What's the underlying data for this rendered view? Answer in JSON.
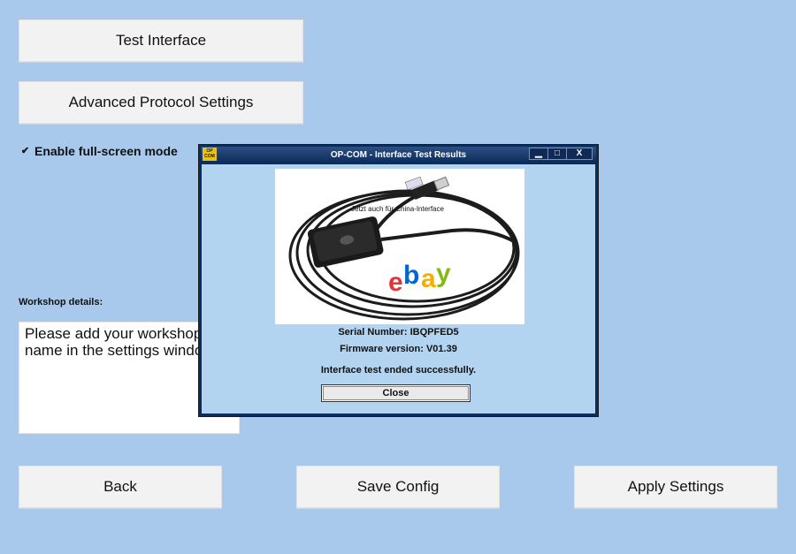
{
  "buttons": {
    "test_interface": "Test Interface",
    "advanced_protocol": "Advanced Protocol Settings",
    "back": "Back",
    "save_config": "Save Config",
    "apply_settings": "Apply Settings"
  },
  "fullscreen": {
    "checked": true,
    "check_glyph": "✔",
    "label": "Enable full-screen mode"
  },
  "workshop": {
    "label": "Workshop details:",
    "text": "Please add your workshop\nname in the settings window"
  },
  "dialog": {
    "icon_text": "OP COM",
    "title": "OP-COM - Interface Test Results",
    "minimize_glyph": "▁",
    "maximize_glyph": "□",
    "close_glyph": "X",
    "photo_caption": "Jetzt auch für China-Interface",
    "photo_watermark": "ebay",
    "serial": "Serial Number: IBQPFED5",
    "firmware": "Firmware version: V01.39",
    "result": "Interface test ended successfully.",
    "close_label": "Close"
  },
  "colors": {
    "background": "#a8c9ec",
    "button": "#f2f2f2",
    "dialog_frame": "#0b2d5c",
    "dialog_body": "#b3d4f1",
    "ebay_red": "#e53238",
    "ebay_blue": "#0064d2",
    "ebay_yellow": "#f5af02",
    "ebay_green": "#86b817"
  }
}
